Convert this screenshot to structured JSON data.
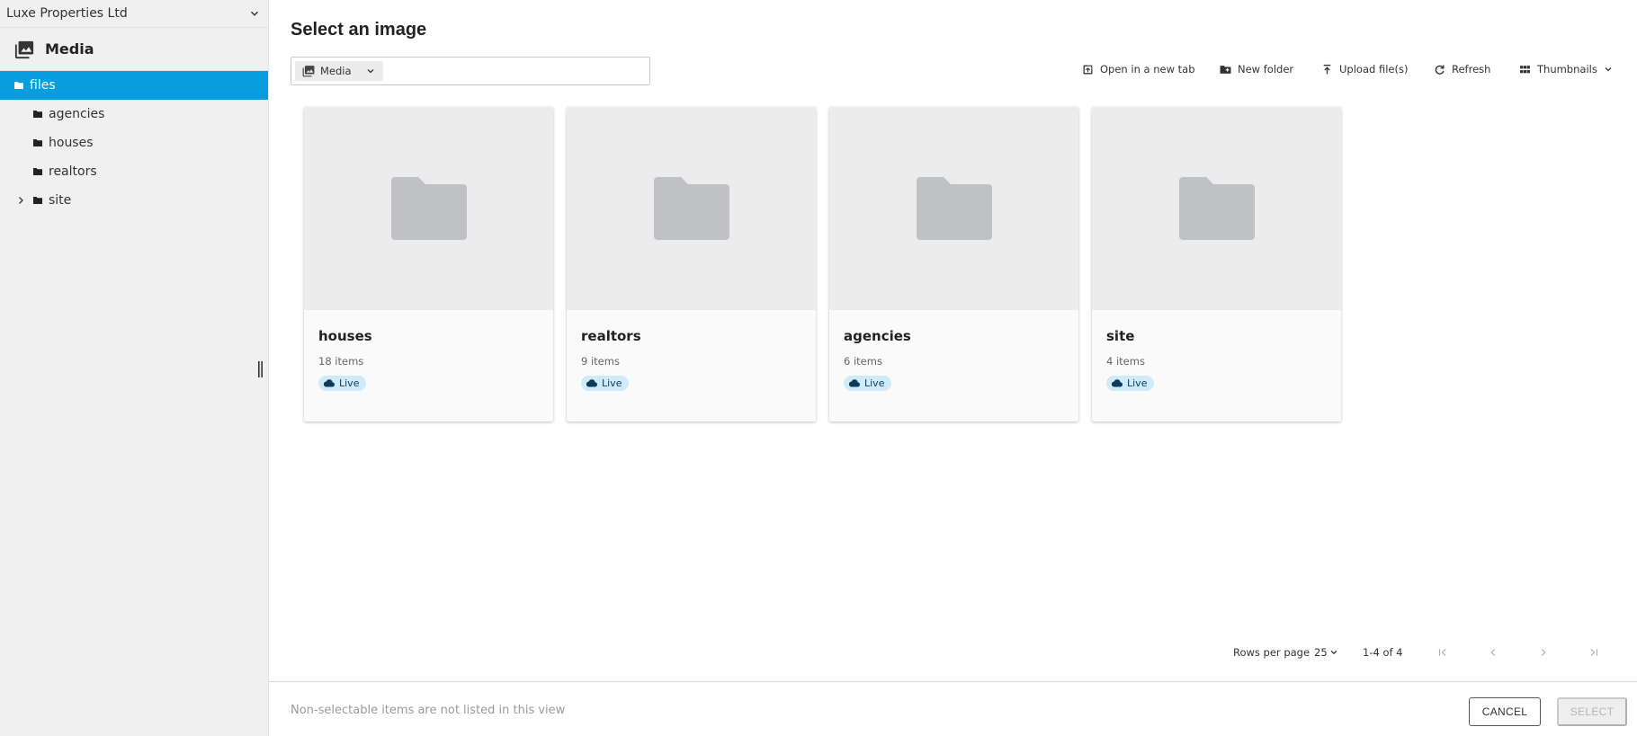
{
  "sidebar": {
    "site_name": "Luxe Properties Ltd",
    "section_title": "Media",
    "tree": [
      {
        "label": "files",
        "selected": true
      },
      {
        "label": "agencies"
      },
      {
        "label": "houses"
      },
      {
        "label": "realtors"
      },
      {
        "label": "site",
        "expandable": true
      }
    ]
  },
  "dialog": {
    "title": "Select an image",
    "path_chip": "Media"
  },
  "toolbar": {
    "open_new_tab": "Open in a new tab",
    "new_folder": "New folder",
    "upload": "Upload file(s)",
    "refresh": "Refresh",
    "view_mode": "Thumbnails"
  },
  "folders": [
    {
      "name": "houses",
      "count": "18 items",
      "status": "Live"
    },
    {
      "name": "realtors",
      "count": "9 items",
      "status": "Live"
    },
    {
      "name": "agencies",
      "count": "6 items",
      "status": "Live"
    },
    {
      "name": "site",
      "count": "4 items",
      "status": "Live"
    }
  ],
  "pagination": {
    "rows_per_page_label": "Rows per page",
    "rows_per_page_value": "25",
    "range": "1-4 of 4"
  },
  "footer": {
    "note": "Non-selectable items are not listed in this view",
    "cancel": "CANCEL",
    "select": "SELECT"
  },
  "colors": {
    "accent": "#079ee0",
    "badge_bg": "#cfeaf8",
    "badge_text": "#0d3c5a",
    "folder_icon": "#c0c1c4"
  },
  "icons": {
    "media": "image-stack-icon",
    "folder": "folder-icon",
    "open_new_tab": "open-in-new-icon",
    "new_folder": "create-new-folder-icon",
    "upload": "upload-icon",
    "refresh": "refresh-icon",
    "view_mode": "grid-view-icon",
    "live": "cloud-icon"
  }
}
